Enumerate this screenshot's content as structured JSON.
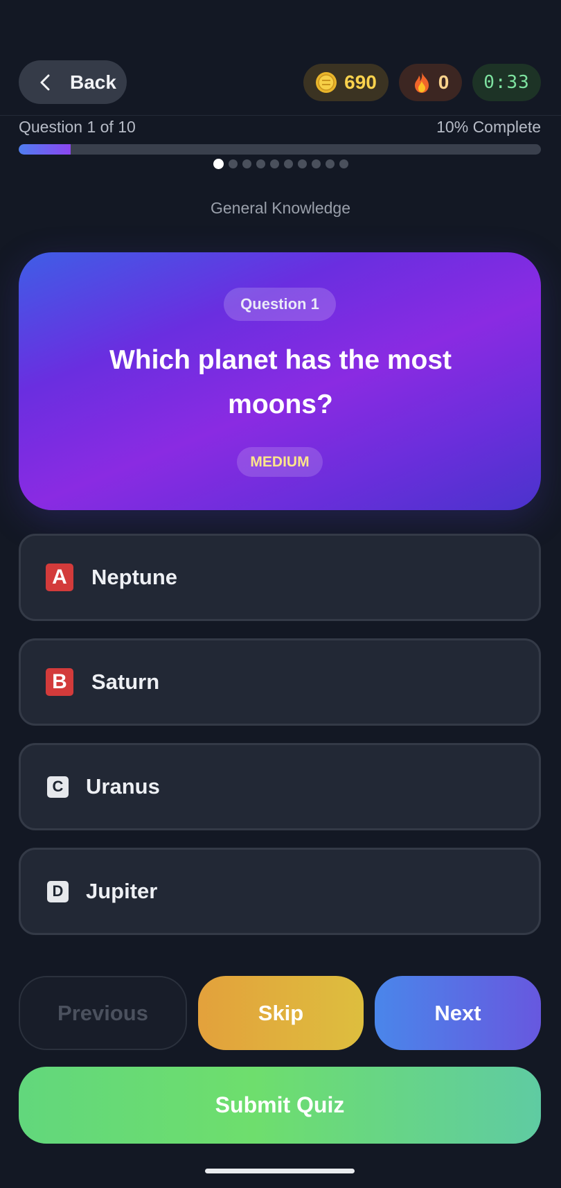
{
  "header": {
    "back_label": "Back",
    "coins": "690",
    "streak": "0",
    "timer": "0:33"
  },
  "progress": {
    "question_count": "Question 1 of 10",
    "percent_label": "10% Complete",
    "fraction": 0.1,
    "total_dots": 10,
    "current_dot": 1
  },
  "category": "General Knowledge",
  "question": {
    "badge": "Question 1",
    "text": "Which planet has the most moons?",
    "difficulty": "MEDIUM"
  },
  "options": [
    {
      "key": "A",
      "text": "Neptune",
      "icon": "letter-a-red-icon"
    },
    {
      "key": "B",
      "text": "Saturn",
      "icon": "letter-b-red-icon"
    },
    {
      "key": "C",
      "text": "Uranus",
      "icon": "letter-c-icon"
    },
    {
      "key": "D",
      "text": "Jupiter",
      "icon": "letter-d-icon"
    }
  ],
  "buttons": {
    "previous": "Previous",
    "skip": "Skip",
    "next": "Next",
    "submit": "Submit Quiz"
  },
  "colors": {
    "background": "#131824",
    "accent_purple": "#8a2be2",
    "coin_text": "#fcd34d",
    "timer_text": "#7ee2a0",
    "submit_green": "#6ede6d"
  }
}
